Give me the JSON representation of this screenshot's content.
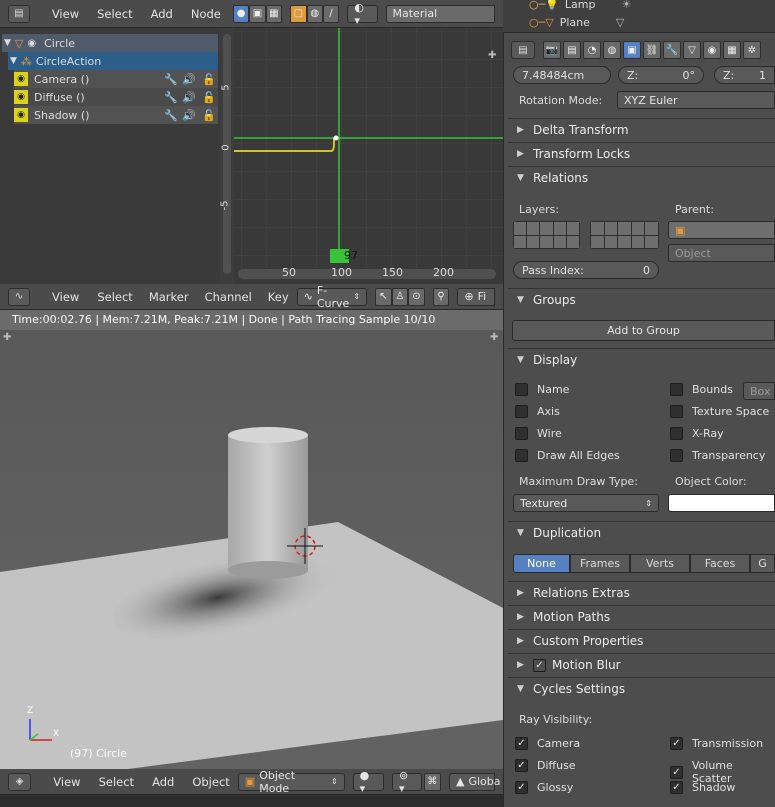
{
  "top_header": {
    "menu": [
      "View",
      "Select",
      "Add",
      "Node"
    ],
    "material_label": "Material"
  },
  "outliner_top": {
    "items": [
      "Lamp",
      "Plane"
    ]
  },
  "dopesheet": {
    "object": "Circle",
    "action": "CircleAction",
    "channels": [
      "Camera ()",
      "Diffuse ()",
      "Shadow ()"
    ]
  },
  "graph": {
    "y_ticks": [
      "5",
      "0",
      "-5"
    ],
    "x_ticks": [
      "50",
      "100",
      "150",
      "200"
    ],
    "current_frame": "97"
  },
  "graph_header": {
    "menu": [
      "View",
      "Select",
      "Marker",
      "Channel",
      "Key"
    ],
    "mode": "F-Curve",
    "truncated": "Fi"
  },
  "viewport": {
    "status": "Time:00:02.76 | Mem:7.21M, Peak:7.21M | Done | Path Tracing Sample 10/10",
    "object_label": "(97) Circle",
    "axis": {
      "z": "Z",
      "x": "X"
    }
  },
  "viewport_header": {
    "menu": [
      "View",
      "Select",
      "Add",
      "Object"
    ],
    "mode": "Object Mode",
    "truncated": "Globa"
  },
  "properties": {
    "loc_x": "7.48484cm",
    "z_label1": "Z:",
    "z_value1": "0°",
    "z_label2": "Z:",
    "z_value2": "1",
    "rotation_mode_label": "Rotation Mode:",
    "rotation_mode_value": "XYZ Euler",
    "panels": {
      "delta": "Delta Transform",
      "locks": "Transform Locks",
      "relations": "Relations",
      "groups": "Groups",
      "display": "Display",
      "duplication": "Duplication",
      "relations_extras": "Relations Extras",
      "motion_paths": "Motion Paths",
      "custom_props": "Custom Properties",
      "motion_blur": "Motion Blur",
      "cycles": "Cycles Settings"
    },
    "relations": {
      "layers_label": "Layers:",
      "parent_label": "Parent:",
      "object_placeholder": "Object",
      "pass_index_label": "Pass Index:",
      "pass_index_value": "0"
    },
    "groups": {
      "add_button": "Add to Group"
    },
    "display": {
      "left": [
        "Name",
        "Axis",
        "Wire",
        "Draw All Edges"
      ],
      "right": [
        "Bounds",
        "Texture Space",
        "X-Ray",
        "Transparency"
      ],
      "bounds_type": "Box",
      "max_draw_label": "Maximum Draw Type:",
      "max_draw_value": "Textured",
      "object_color_label": "Object Color:"
    },
    "duplication": {
      "options": [
        "None",
        "Frames",
        "Verts",
        "Faces",
        "G"
      ],
      "active": "None"
    },
    "cycles": {
      "ray_visibility_label": "Ray Visibility:",
      "left": [
        "Camera",
        "Diffuse",
        "Glossy"
      ],
      "right": [
        "Transmission",
        "Volume Scatter",
        "Shadow"
      ]
    }
  },
  "colors": {
    "accent": "#5680c2",
    "curve_green": "#39c339",
    "curve_yellow": "#d4c51a",
    "channel_yellow": "#d9d41a"
  }
}
